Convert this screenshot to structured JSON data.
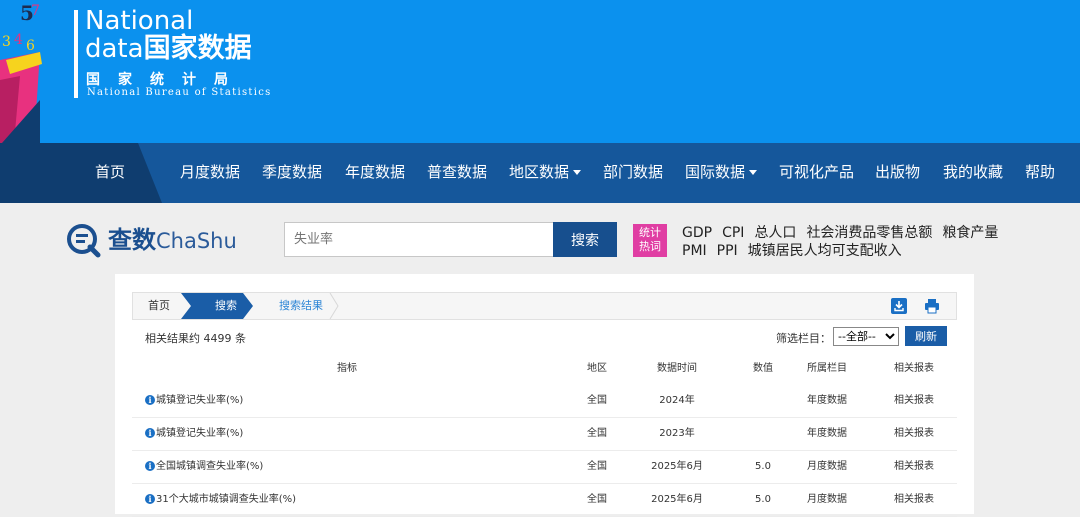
{
  "header": {
    "logo_en_line1": "National",
    "logo_en_line2": "data",
    "logo_cn": "国家数据",
    "logo_cn_small": "国家统计局",
    "logo_en_sub": "National Bureau of Statistics"
  },
  "nav": {
    "items": [
      {
        "label": "首页"
      },
      {
        "label": "月度数据"
      },
      {
        "label": "季度数据"
      },
      {
        "label": "年度数据"
      },
      {
        "label": "普查数据"
      },
      {
        "label": "地区数据",
        "dropdown": true
      },
      {
        "label": "部门数据"
      },
      {
        "label": "国际数据",
        "dropdown": true
      },
      {
        "label": "可视化产品"
      },
      {
        "label": "出版物"
      },
      {
        "label": "我的收藏"
      },
      {
        "label": "帮助"
      }
    ]
  },
  "search": {
    "logo_cn": "查数",
    "logo_en": "ChaShu",
    "placeholder": "失业率",
    "button": "搜索",
    "hot_badge_line1": "统计",
    "hot_badge_line2": "热词",
    "hot_line1": [
      "GDP",
      "CPI",
      "总人口",
      "社会消费品零售总额",
      "粮食产量"
    ],
    "hot_line2": [
      "PMI",
      "PPI",
      "城镇居民人均可支配收入"
    ]
  },
  "breadcrumb": {
    "home": "首页",
    "search": "搜索",
    "results": "搜索结果"
  },
  "results": {
    "count_text": "相关结果约 4499 条",
    "filter_label": "筛选栏目：",
    "filter_value": "--全部--",
    "refresh": "刷新"
  },
  "table": {
    "headers": {
      "name": "指标",
      "region": "地区",
      "time": "数据时间",
      "value": "数值",
      "category": "所属栏目",
      "report": "相关报表"
    },
    "rows": [
      {
        "name": "城镇登记失业率(%)",
        "region": "全国",
        "time": "2024年",
        "value": "",
        "category": "年度数据",
        "report": "相关报表"
      },
      {
        "name": "城镇登记失业率(%)",
        "region": "全国",
        "time": "2023年",
        "value": "",
        "category": "年度数据",
        "report": "相关报表"
      },
      {
        "name": "全国城镇调查失业率(%)",
        "region": "全国",
        "time": "2025年6月",
        "value": "5.0",
        "category": "月度数据",
        "report": "相关报表"
      },
      {
        "name": "31个大城市城镇调查失业率(%)",
        "region": "全国",
        "time": "2025年6月",
        "value": "5.0",
        "category": "月度数据",
        "report": "相关报表"
      }
    ]
  },
  "colors": {
    "header_bg": "#0b91ee",
    "nav_bg": "#15579b",
    "accent": "#1a5da7",
    "hot_badge": "#e03ea3"
  }
}
